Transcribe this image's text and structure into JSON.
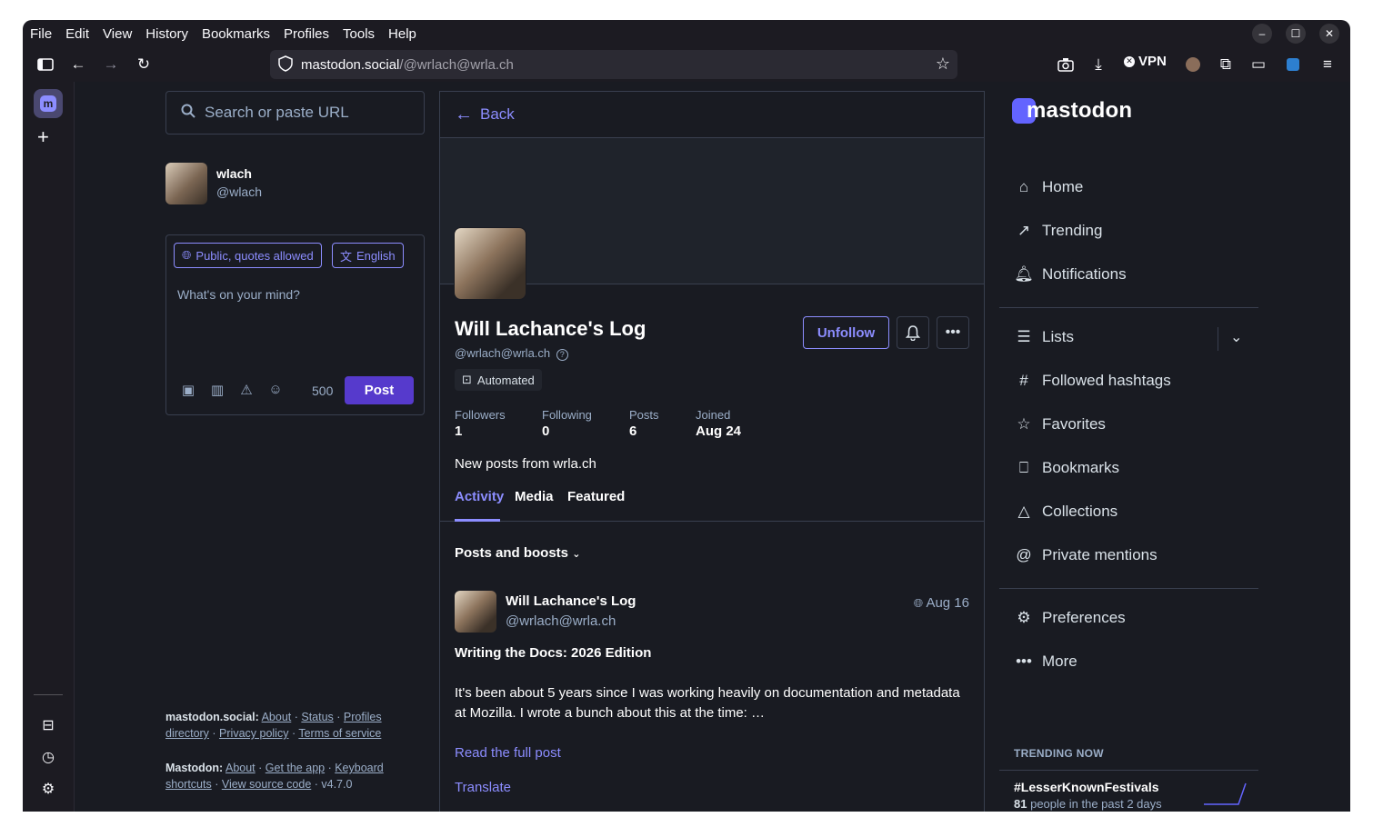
{
  "browser": {
    "menu": [
      "File",
      "Edit",
      "View",
      "History",
      "Bookmarks",
      "Profiles",
      "Tools",
      "Help"
    ],
    "url_host": "mastodon.social",
    "url_path": "/@wrlach@wrla.ch",
    "vpn_label": "VPN"
  },
  "left": {
    "search_placeholder": "Search or paste URL",
    "me": {
      "name": "wlach",
      "handle": "@wlach"
    },
    "visibility": "Public, quotes allowed",
    "language": "English",
    "compose_placeholder": "What's on your mind?",
    "char_count": "500",
    "post_label": "Post",
    "footer": {
      "line1_head": "mastodon.social:",
      "line1_links": [
        "About",
        "Status",
        "Profiles directory",
        "Privacy policy",
        "Terms of service"
      ],
      "line2_head": "Mastodon:",
      "line2_links": [
        "About",
        "Get the app",
        "Keyboard shortcuts",
        "View source code"
      ],
      "version": "v4.7.0"
    }
  },
  "profile": {
    "back_label": "Back",
    "name": "Will Lachance's Log",
    "handle": "@wrlach@wrla.ch",
    "badge": "Automated",
    "unfollow_label": "Unfollow",
    "stats": [
      {
        "label": "Followers",
        "value": "1"
      },
      {
        "label": "Following",
        "value": "0"
      },
      {
        "label": "Posts",
        "value": "6"
      },
      {
        "label": "Joined",
        "value": "Aug 24"
      }
    ],
    "bio": "New posts from wrla.ch",
    "tabs": [
      "Activity",
      "Media",
      "Featured"
    ],
    "filter": "Posts and boosts",
    "post": {
      "name": "Will Lachance's Log",
      "handle": "@wrlach@wrla.ch",
      "date": "Aug 16",
      "title": "Writing the Docs: 2026 Edition",
      "body": "It's been about 5 years since I was working heavily on documentation and metadata at Mozilla. I wrote a bunch about this at the time: …",
      "read_more": "Read the full post",
      "translate": "Translate"
    }
  },
  "right": {
    "logo": "mastodon",
    "nav1": [
      {
        "label": "Home",
        "icon": "home-icon"
      },
      {
        "label": "Trending",
        "icon": "trending-icon"
      },
      {
        "label": "Notifications",
        "icon": "bell-icon"
      }
    ],
    "nav2": [
      {
        "label": "Lists",
        "icon": "list-icon"
      },
      {
        "label": "Followed hashtags",
        "icon": "hashtag-icon"
      },
      {
        "label": "Favorites",
        "icon": "star-icon"
      },
      {
        "label": "Bookmarks",
        "icon": "bookmark-icon"
      },
      {
        "label": "Collections",
        "icon": "shapes-icon"
      },
      {
        "label": "Private mentions",
        "icon": "at-icon"
      }
    ],
    "nav3": [
      {
        "label": "Preferences",
        "icon": "gear-icon"
      },
      {
        "label": "More",
        "icon": "more-icon"
      }
    ],
    "trending_head": "TRENDING NOW",
    "trend": {
      "tag": "#LesserKnownFestivals",
      "count": "81",
      "suffix": "people in the past 2 days"
    }
  },
  "colors": {
    "accent": "#8c8dff",
    "button": "#563acc",
    "bg": "#191b22"
  }
}
